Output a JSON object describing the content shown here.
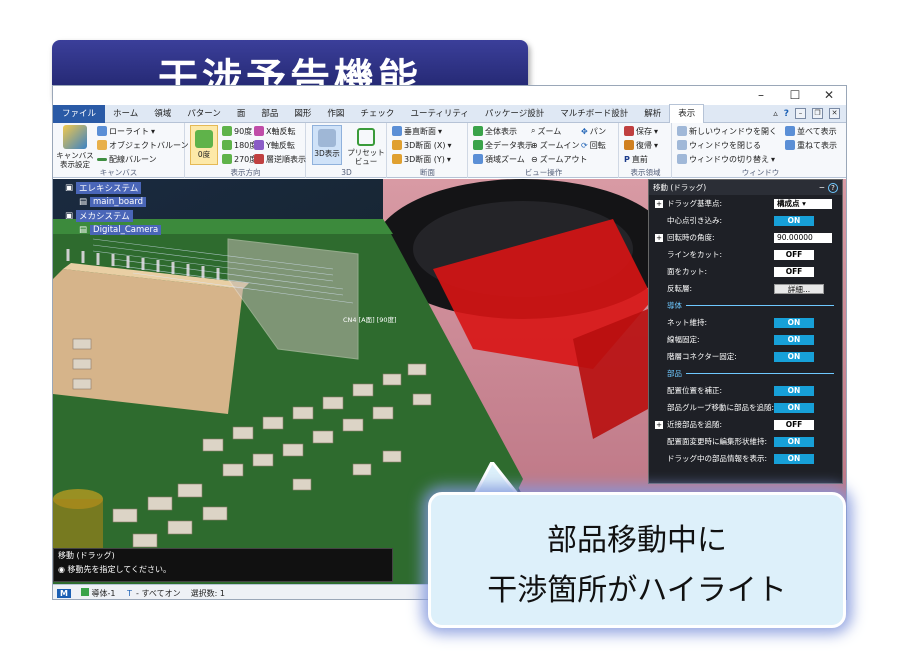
{
  "banner": {
    "title": "干涉予告機能"
  },
  "window": {
    "minimize": "–",
    "maximize": "☐",
    "close": "✕"
  },
  "tabs": [
    "ファイル",
    "ホーム",
    "領域",
    "パターン",
    "面",
    "部品",
    "図形",
    "作図",
    "チェック",
    "ユーティリティ",
    "パッケージ設計",
    "マルチボード設計",
    "解析",
    "表示"
  ],
  "tab_right": {
    "help": "?"
  },
  "ribbon": {
    "canvas": {
      "big": "キャンバス表示設定",
      "items": [
        "ローライト",
        "オブジェクトバルーン",
        "配線バルーン"
      ],
      "label": "キャンバス"
    },
    "direction": {
      "big": "0度",
      "items": [
        "90度",
        "180度",
        "270度",
        "X軸反転",
        "Y軸反転",
        "層逆順表示"
      ],
      "label": "表示方向"
    },
    "threeD": {
      "items": [
        "3D表示",
        "プリセットビュー"
      ],
      "label": "3D"
    },
    "section": {
      "items": [
        "垂直断面",
        "3D断面 (X)",
        "3D断面 (Y)"
      ],
      "label": "断面"
    },
    "view": {
      "items": [
        "全体表示",
        "全データ表示",
        "領域ズーム",
        "ズーム",
        "ズームイン",
        "ズームアウト",
        "パン",
        "回転"
      ],
      "label": "ビュー操作"
    },
    "region": {
      "items": [
        "保存",
        "復帰",
        "直前"
      ],
      "label": "表示領域"
    },
    "window": {
      "items": [
        "新しいウィンドウを開く",
        "ウィンドウを閉じる",
        "ウィンドウの切り替え",
        "並べて表示",
        "重ねて表示"
      ],
      "label": "ウィンドウ"
    }
  },
  "tree": {
    "elec": "エレキシステム",
    "board": "main_board",
    "mech": "メカシステム",
    "camera": "Digital_Camera"
  },
  "viewport": {
    "tooltip": "CN4 [A面] [90度]"
  },
  "panel": {
    "title": "移動 (ドラッグ)",
    "rows": [
      {
        "label": "ドラッグ基準点:",
        "value": "構成点",
        "kind": "sel",
        "plus": true
      },
      {
        "label": "中心点引き込み:",
        "value": "ON",
        "kind": "on"
      },
      {
        "label": "回転時の角度:",
        "value": "90.00000",
        "kind": "num",
        "plus": true
      },
      {
        "label": "ラインをカット:",
        "value": "OFF",
        "kind": "off"
      },
      {
        "label": "面をカット:",
        "value": "OFF",
        "kind": "off"
      },
      {
        "label": "反転層:",
        "value": "詳細...",
        "kind": "btn"
      }
    ],
    "section1": "導体",
    "rows2": [
      {
        "label": "ネット維持:",
        "value": "ON",
        "kind": "on"
      },
      {
        "label": "線幅固定:",
        "value": "ON",
        "kind": "on"
      },
      {
        "label": "階層コネクター固定:",
        "value": "ON",
        "kind": "on"
      }
    ],
    "section2": "部品",
    "rows3": [
      {
        "label": "配置位置を補正:",
        "value": "ON",
        "kind": "on"
      },
      {
        "label": "部品グループ移動に部品を追随:",
        "value": "ON",
        "kind": "on"
      },
      {
        "label": "近接部品を追随:",
        "value": "OFF",
        "kind": "off",
        "plus": true
      },
      {
        "label": "配置面変更時に編集形状維持:",
        "value": "ON",
        "kind": "on"
      },
      {
        "label": "ドラッグ中の部品情報を表示:",
        "value": "ON",
        "kind": "on"
      }
    ]
  },
  "command": {
    "line1": "移動 (ドラッグ)",
    "line2": "移動先を指定してください。"
  },
  "status": {
    "layer": "導体-1",
    "filter": "すべてオン",
    "selection": "選択数: 1"
  },
  "callout": {
    "line1": "部品移動中に",
    "line2": "干渉箇所がハイライト"
  },
  "colors": {
    "banner": "#2a2e80",
    "accent_on": "#17a0d8",
    "highlight": "#e01010",
    "board": "#2e6b2e"
  }
}
